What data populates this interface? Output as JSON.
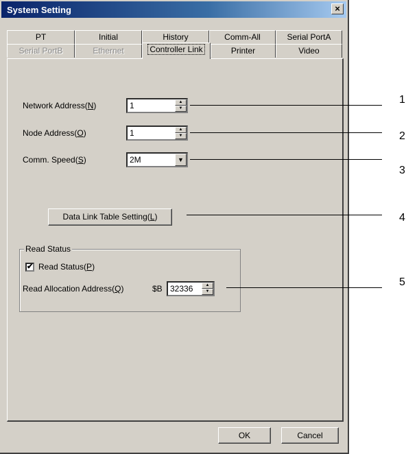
{
  "dialog": {
    "title": "System Setting",
    "close_label": "×"
  },
  "tabs_row1": [
    {
      "label": "PT"
    },
    {
      "label": "Initial"
    },
    {
      "label": "History"
    },
    {
      "label": "Comm-All"
    },
    {
      "label": "Serial PortA"
    }
  ],
  "tabs_row2": [
    {
      "label": "Serial PortB"
    },
    {
      "label": "Ethernet"
    },
    {
      "label": "Controller Link"
    },
    {
      "label": "Printer"
    },
    {
      "label": "Video"
    }
  ],
  "form": {
    "network_address": {
      "label": "Network Address",
      "key": "N",
      "value": "1"
    },
    "node_address": {
      "label": "Node Address",
      "key": "O",
      "value": "1"
    },
    "comm_speed": {
      "label": "Comm. Speed",
      "key": "S",
      "value": "2M"
    },
    "data_link_button": {
      "label": "Data Link Table Setting",
      "key": "L"
    }
  },
  "read_status_group": {
    "title": "Read Status",
    "checkbox": {
      "label": "Read Status",
      "key": "P",
      "checked": true,
      "mark": "✔"
    },
    "allocation": {
      "label": "Read Allocation Address",
      "key": "Q",
      "prefix": "$B",
      "value": "32336"
    }
  },
  "footer": {
    "ok_label": "OK",
    "cancel_label": "Cancel"
  },
  "callouts": [
    "1",
    "2",
    "3",
    "4",
    "5"
  ]
}
